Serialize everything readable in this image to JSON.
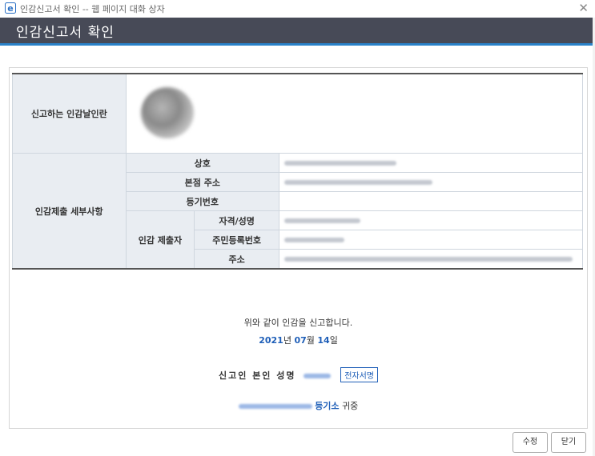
{
  "window": {
    "title": "인감신고서 확인 -- 웹 페이지 대화 상자",
    "close_glyph": "✕"
  },
  "header": {
    "title": "인감신고서 확인"
  },
  "table": {
    "seal_row_label": "신고하는 인감날인란",
    "details_label": "인감제출 세부사항",
    "rows": {
      "company": "상호",
      "hq_address": "본점 주소",
      "reg_number": "등기번호",
      "submitter": "인감 제출자",
      "qual_name": "자격/성명",
      "resident_no": "주민등록번호",
      "address": "주소"
    }
  },
  "declaration": {
    "text": "위와 같이 인감을 신고합니다.",
    "year": "2021",
    "year_unit": "년",
    "month": "07",
    "month_unit": "월",
    "day": "14",
    "day_unit": "일",
    "signer_label": "신고인 본인 성명",
    "esign_button": "전자서명",
    "office_label": "등기소",
    "office_suffix": "귀중"
  },
  "buttons": {
    "edit": "수정",
    "close": "닫기"
  },
  "colors": {
    "header_bg": "#474a57",
    "accent": "#2a82c9",
    "link_blue": "#1f5fb8",
    "label_bg": "#e9edf2"
  }
}
